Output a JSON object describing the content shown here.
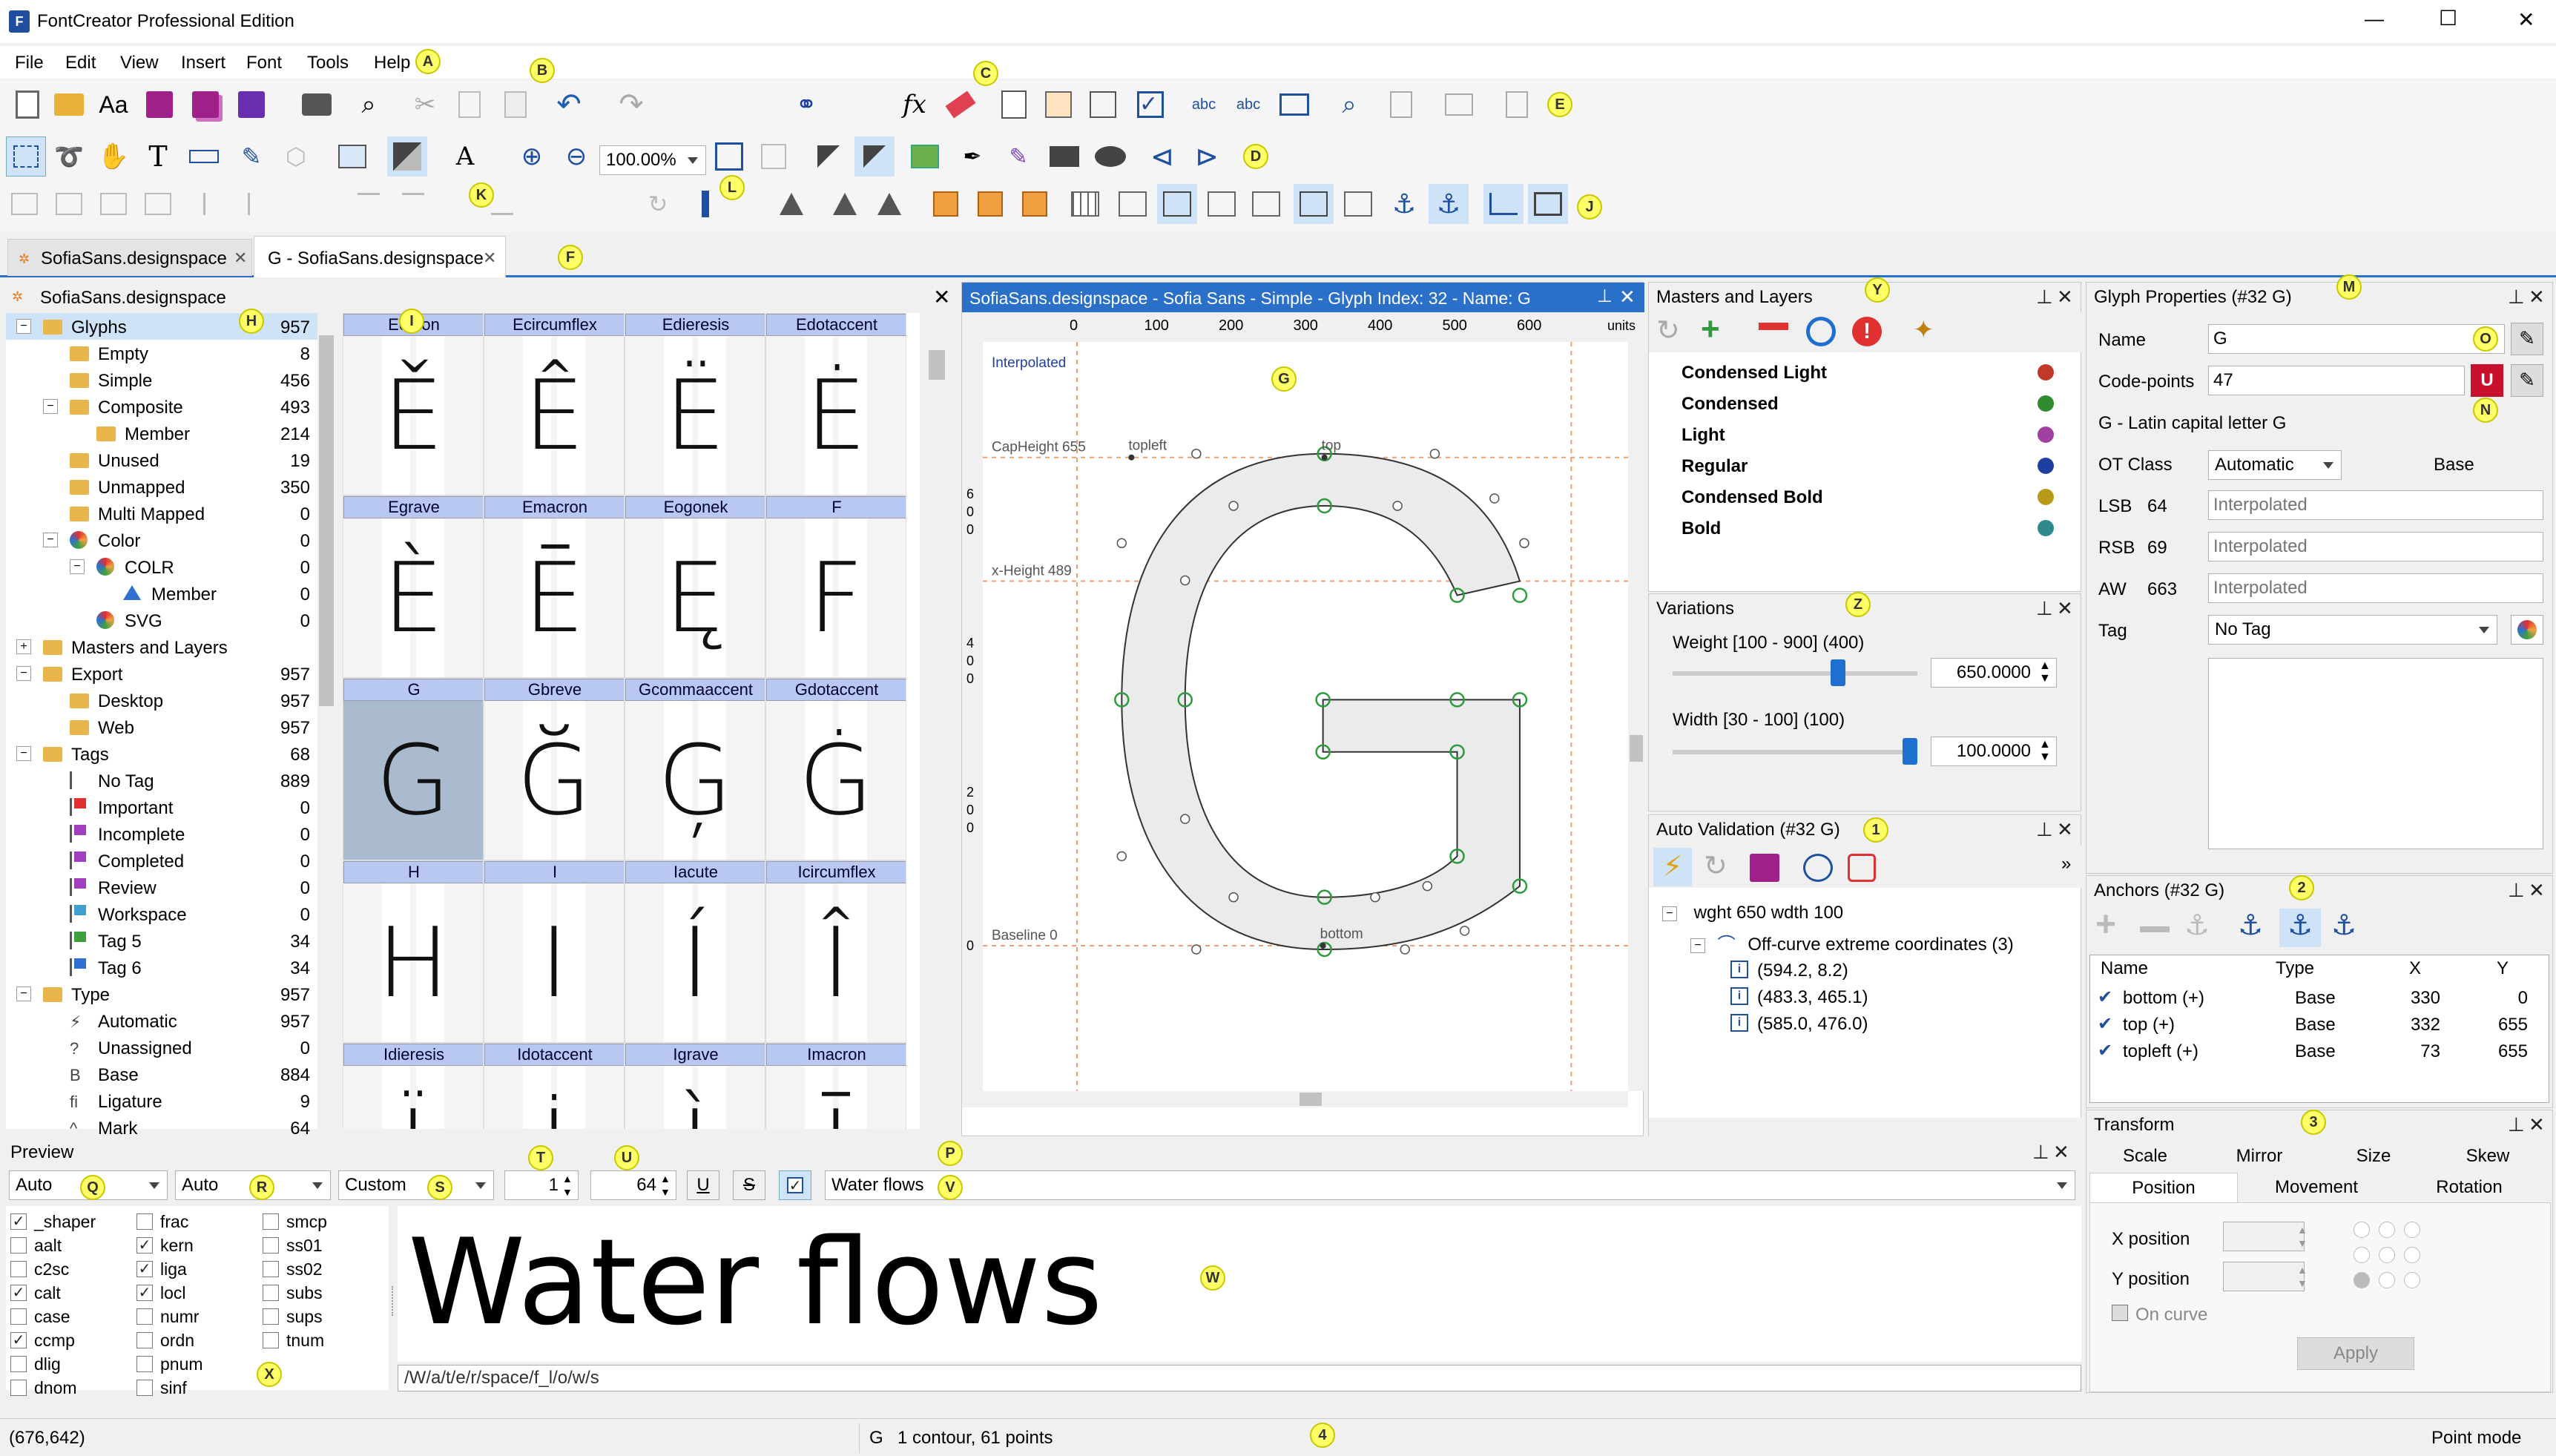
{
  "app": {
    "title": "FontCreator Professional Edition",
    "win_min": "—",
    "win_max": "☐",
    "win_close": "✕"
  },
  "menu": [
    "File",
    "Edit",
    "View",
    "Insert",
    "Font",
    "Tools",
    "Help"
  ],
  "zoom": "100.00%",
  "tabs": [
    {
      "label": "SofiaSans.designspace"
    },
    {
      "label": "G - SofiaSans.designspace"
    }
  ],
  "callouts": {
    "A": "A",
    "B": "B",
    "C": "C",
    "D": "D",
    "E": "E",
    "F": "F",
    "G": "G",
    "H": "H",
    "I": "I",
    "J": "J",
    "K": "K",
    "L": "L",
    "M": "M",
    "N": "N",
    "O": "O",
    "P": "P",
    "Q": "Q",
    "R": "R",
    "S": "S",
    "T": "T",
    "U": "U",
    "V": "V",
    "W": "W",
    "X": "X",
    "Y": "Y",
    "Z": "Z",
    "n1": "1",
    "n2": "2",
    "n3": "3",
    "n4": "4"
  },
  "tree": {
    "title": "SofiaSans.designspace",
    "items": [
      {
        "label": "Glyphs",
        "count": "957"
      },
      {
        "label": "Empty",
        "count": "8"
      },
      {
        "label": "Simple",
        "count": "456"
      },
      {
        "label": "Composite",
        "count": "493"
      },
      {
        "label": "Member",
        "count": "214"
      },
      {
        "label": "Unused",
        "count": "19"
      },
      {
        "label": "Unmapped",
        "count": "350"
      },
      {
        "label": "Multi Mapped",
        "count": "0"
      },
      {
        "label": "Color",
        "count": "0"
      },
      {
        "label": "COLR",
        "count": "0"
      },
      {
        "label": "Member",
        "count": "0"
      },
      {
        "label": "SVG",
        "count": "0"
      },
      {
        "label": "Masters and Layers",
        "count": ""
      },
      {
        "label": "Export",
        "count": "957"
      },
      {
        "label": "Desktop",
        "count": "957"
      },
      {
        "label": "Web",
        "count": "957"
      },
      {
        "label": "Tags",
        "count": "68"
      },
      {
        "label": "No Tag",
        "count": "889"
      },
      {
        "label": "Important",
        "count": "0"
      },
      {
        "label": "Incomplete",
        "count": "0"
      },
      {
        "label": "Completed",
        "count": "0"
      },
      {
        "label": "Review",
        "count": "0"
      },
      {
        "label": "Workspace",
        "count": "0"
      },
      {
        "label": "Tag 5",
        "count": "34"
      },
      {
        "label": "Tag 6",
        "count": "34"
      },
      {
        "label": "Type",
        "count": "957"
      },
      {
        "label": "Automatic",
        "count": "957"
      },
      {
        "label": "Unassigned",
        "count": "0"
      },
      {
        "label": "Base",
        "count": "884"
      },
      {
        "label": "Ligature",
        "count": "9"
      },
      {
        "label": "Mark",
        "count": "64"
      }
    ]
  },
  "glyph_grid": [
    {
      "name": "Ecaron",
      "char": "Ě"
    },
    {
      "name": "Ecircumflex",
      "char": "Ê"
    },
    {
      "name": "Edieresis",
      "char": "Ë"
    },
    {
      "name": "Edotaccent",
      "char": "Ė"
    },
    {
      "name": "Egrave",
      "char": "È"
    },
    {
      "name": "Emacron",
      "char": "Ē"
    },
    {
      "name": "Eogonek",
      "char": "Ę"
    },
    {
      "name": "F",
      "char": "F"
    },
    {
      "name": "G",
      "char": "G"
    },
    {
      "name": "Gbreve",
      "char": "Ğ"
    },
    {
      "name": "Gcommaaccent",
      "char": "Ģ"
    },
    {
      "name": "Gdotaccent",
      "char": "Ġ"
    },
    {
      "name": "H",
      "char": "H"
    },
    {
      "name": "I",
      "char": "I"
    },
    {
      "name": "Iacute",
      "char": "Í"
    },
    {
      "name": "Icircumflex",
      "char": "Î"
    },
    {
      "name": "Idieresis",
      "char": "Ï"
    },
    {
      "name": "Idotaccent",
      "char": "İ"
    },
    {
      "name": "Igrave",
      "char": "Ì"
    },
    {
      "name": "Imacron",
      "char": "Ī"
    }
  ],
  "editor": {
    "title": "SofiaSans.designspace - Sofia Sans - Simple - Glyph Index: 32 - Name: G",
    "ruler": [
      "0",
      "100",
      "200",
      "300",
      "400",
      "500",
      "600"
    ],
    "units": "units",
    "interpolated": "Interpolated",
    "cap": "CapHeight 655",
    "xh": "x-Height 489",
    "base": "Baseline 0",
    "anchors": {
      "topleft": "topleft",
      "top": "top",
      "bottom": "bottom"
    },
    "vruler": [
      "6\n0\n0",
      "4\n0\n0",
      "2\n0\n0",
      "0"
    ]
  },
  "masters": {
    "title": "Masters and Layers",
    "items": [
      {
        "label": "Condensed Light",
        "color": "#c0392b"
      },
      {
        "label": "Condensed",
        "color": "#2e8b2e"
      },
      {
        "label": "Light",
        "color": "#a040a0"
      },
      {
        "label": "Regular",
        "color": "#1f3fa0"
      },
      {
        "label": "Condensed Bold",
        "color": "#b89a1a"
      },
      {
        "label": "Bold",
        "color": "#2e8b8b"
      }
    ]
  },
  "variations": {
    "title": "Variations",
    "weight": {
      "label": "Weight [100 - 900] (400)",
      "value": "650.0000",
      "level": 0.6875
    },
    "width": {
      "label": "Width [30 - 100] (100)",
      "value": "100.0000",
      "level": 1.0
    }
  },
  "validation": {
    "title": "Auto Validation (#32 G)",
    "root": "wght 650 wdth 100",
    "group": "Off-curve extreme coordinates (3)",
    "items": [
      "(594.2,  8.2)",
      "(483.3, 465.1)",
      "(585.0, 476.0)"
    ]
  },
  "props": {
    "title": "Glyph Properties (#32 G)",
    "name_label": "Name",
    "name_value": "G",
    "cp_label": "Code-points",
    "cp_value": "47",
    "desc": "G - Latin capital letter G",
    "otclass_label": "OT Class",
    "otclass_value": "Automatic",
    "otclass_extra": "Base",
    "lsb_label": "LSB",
    "lsb_value": "64",
    "rsb_label": "RSB",
    "rsb_value": "69",
    "aw_label": "AW",
    "aw_value": "663",
    "interp": "Interpolated",
    "tag_label": "Tag",
    "tag_value": "No Tag"
  },
  "anchors": {
    "title": "Anchors (#32 G)",
    "headers": [
      "Name",
      "Type",
      "X",
      "Y"
    ],
    "rows": [
      {
        "name": "bottom (+)",
        "type": "Base",
        "x": "330",
        "y": "0"
      },
      {
        "name": "top (+)",
        "type": "Base",
        "x": "332",
        "y": "655"
      },
      {
        "name": "topleft (+)",
        "type": "Base",
        "x": "73",
        "y": "655"
      }
    ]
  },
  "transform": {
    "title": "Transform",
    "tabs1": [
      "Scale",
      "Mirror",
      "Size",
      "Skew"
    ],
    "tabs2": [
      "Position",
      "Movement",
      "Rotation"
    ],
    "xpos": "X position",
    "ypos": "Y position",
    "oncurve": "On curve",
    "apply": "Apply"
  },
  "preview": {
    "title": "Preview",
    "dd1": "Auto",
    "dd2": "Auto",
    "dd3": "Custom",
    "spin1": "1",
    "spin2": "64",
    "u": "U",
    "s": "S",
    "text": "Water flows",
    "big": "Water flows",
    "glyphpath": "/W/a/t/e/r/space/f_l/o/w/s",
    "features": [
      {
        "tag": "_shaper",
        "on": true
      },
      {
        "tag": "frac",
        "on": false
      },
      {
        "tag": "smcp",
        "on": false
      },
      {
        "tag": "aalt",
        "on": false
      },
      {
        "tag": "kern",
        "on": true
      },
      {
        "tag": "ss01",
        "on": false
      },
      {
        "tag": "c2sc",
        "on": false
      },
      {
        "tag": "liga",
        "on": true
      },
      {
        "tag": "ss02",
        "on": false
      },
      {
        "tag": "calt",
        "on": true
      },
      {
        "tag": "locl",
        "on": true
      },
      {
        "tag": "subs",
        "on": false
      },
      {
        "tag": "case",
        "on": false
      },
      {
        "tag": "numr",
        "on": false
      },
      {
        "tag": "sups",
        "on": false
      },
      {
        "tag": "ccmp",
        "on": true
      },
      {
        "tag": "ordn",
        "on": false
      },
      {
        "tag": "tnum",
        "on": false
      },
      {
        "tag": "dlig",
        "on": false
      },
      {
        "tag": "pnum",
        "on": false
      },
      {
        "tag": "dnom",
        "on": false
      },
      {
        "tag": "sinf",
        "on": false
      }
    ]
  },
  "status": {
    "coords": "(676,642)",
    "glyph": "G",
    "info": "1 contour, 61 points",
    "mode": "Point mode"
  }
}
